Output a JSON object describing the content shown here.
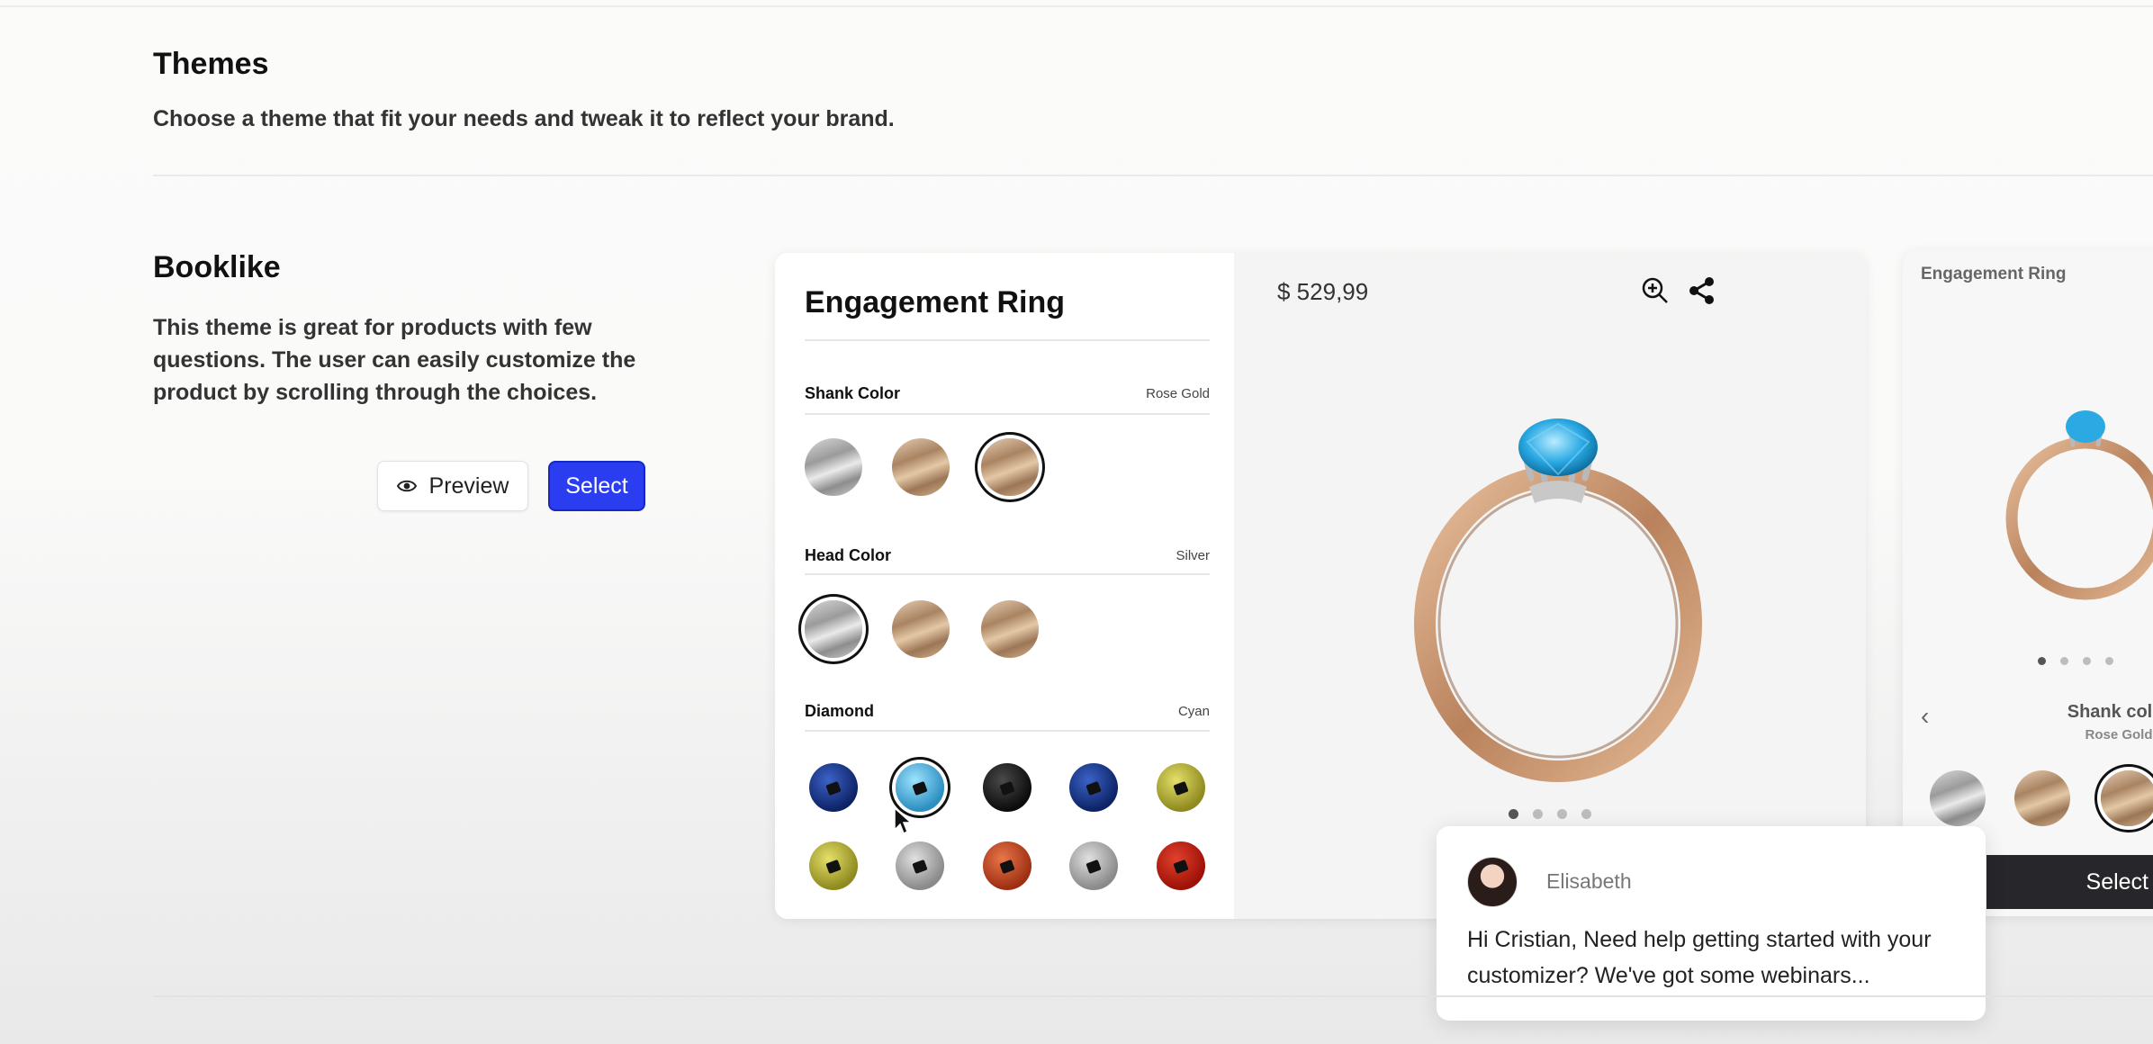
{
  "themes": {
    "title": "Themes",
    "subtitle": "Choose a theme that fit your needs and tweak it to reflect your brand."
  },
  "booklike": {
    "title": "Booklike",
    "description": "This theme is great for products with few questions. The user can easily customize the product by scrolling through the choices.",
    "preview_label": "Preview",
    "select_label": "Select"
  },
  "card": {
    "product_title": "Engagement Ring",
    "price": "$ 529,99",
    "options": [
      {
        "label": "Shank Color",
        "value": "Rose Gold"
      },
      {
        "label": "Head Color",
        "value": "Silver"
      },
      {
        "label": "Diamond",
        "value": "Cyan"
      }
    ],
    "image_dots_count": 4,
    "active_dot": 1
  },
  "card2": {
    "title": "Engagement Ring",
    "option_label": "Shank color",
    "option_value": "Rose Gold",
    "select_label": "Select"
  },
  "chat": {
    "name": "Elisabeth",
    "message": "Hi Cristian, Need help getting started with your customizer? We've got some webinars..."
  },
  "colors": {
    "primary_button": "#2a3df0",
    "dark_button": "#26262b",
    "ring_gold": "#c9946f",
    "gem_cyan": "#2aa9e3"
  }
}
